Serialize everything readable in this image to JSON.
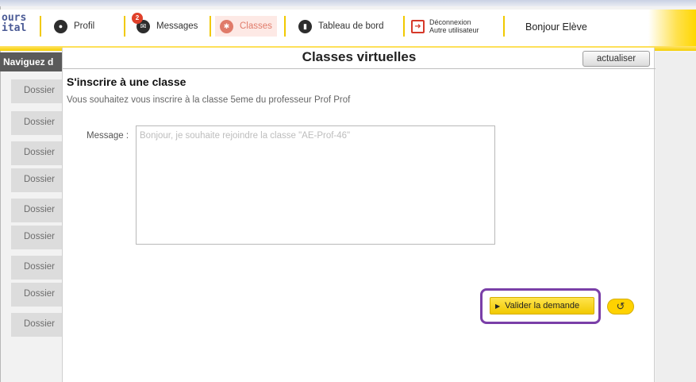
{
  "header": {
    "logo_lines": [
      "ours",
      "ital"
    ],
    "nav": {
      "profile": "Profil",
      "messages": "Messages",
      "messages_badge": "2",
      "classes": "Classes",
      "dashboard": "Tableau de bord",
      "logout_line1": "Déconnexion",
      "logout_line2": "Autre utilisateur"
    },
    "greeting": "Bonjour Elève"
  },
  "sidebar": {
    "heading": "Naviguez d",
    "folders": [
      "Dossier",
      "Dossier",
      "Dossier",
      "Dossier",
      "Dossier",
      "Dossier",
      "Dossier",
      "Dossier",
      "Dossier"
    ]
  },
  "dialog": {
    "title": "Classes virtuelles",
    "refresh_label": "actualiser",
    "section_title": "S'inscrire à une classe",
    "description": "Vous souhaitez vous inscrire à la classe 5eme du professeur Prof Prof",
    "message_label": "Message :",
    "message_placeholder": "Bonjour, je souhaite rejoindre la classe \"AE-Prof-46\"",
    "submit_label": "Valider la demande"
  },
  "colors": {
    "accent_yellow": "#ffd700",
    "highlight_purple": "#7a3fa8",
    "active_tab": "#e07b6a"
  },
  "icons": {
    "profile": "user-icon",
    "messages": "envelope-icon",
    "classes": "classes-icon",
    "dashboard": "chart-icon",
    "logout": "logout-icon",
    "back": "undo-arrow-icon"
  }
}
